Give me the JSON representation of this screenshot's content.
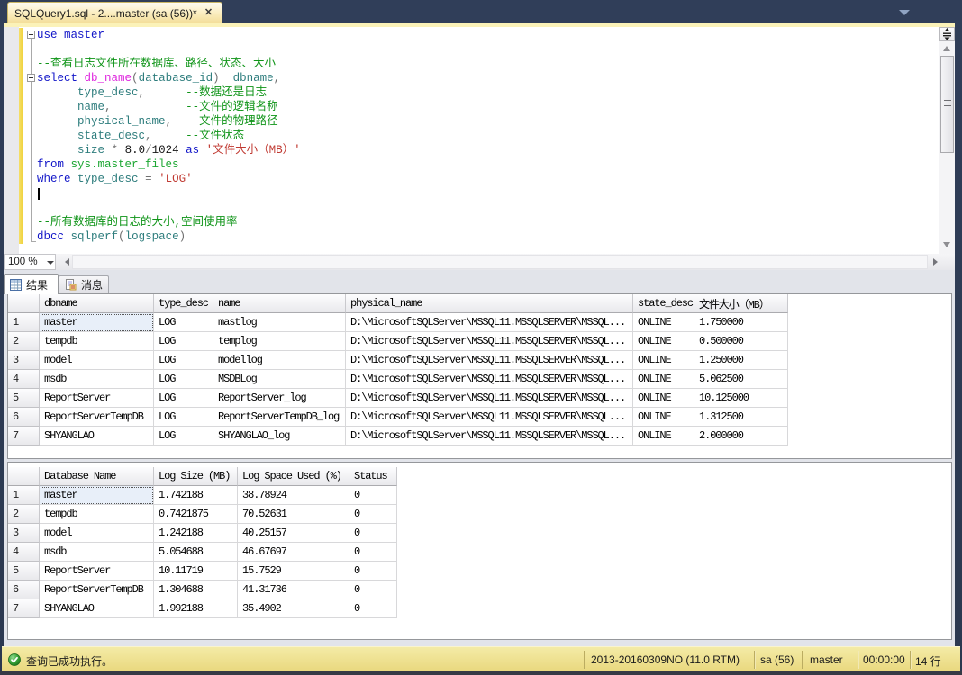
{
  "window": {
    "tab_title": "SQLQuery1.sql - 2....master (sa (56))*",
    "close_glyph": "✕"
  },
  "editor": {
    "zoom_value": "100 %",
    "lines": [
      [
        [
          "kw",
          "use"
        ],
        [
          "pl",
          " "
        ],
        [
          "kw",
          "master"
        ]
      ],
      [],
      [
        [
          "cm",
          "--查看日志文件所在数据库、路径、状态、大小"
        ]
      ],
      [
        [
          "kw",
          "select"
        ],
        [
          "pl",
          " "
        ],
        [
          "fn",
          "db_name"
        ],
        [
          "op",
          "("
        ],
        [
          "id",
          "database_id"
        ],
        [
          "op",
          ")"
        ],
        [
          "pl",
          "  "
        ],
        [
          "id",
          "dbname"
        ],
        [
          "op",
          ","
        ]
      ],
      [
        [
          "pl",
          "      "
        ],
        [
          "id",
          "type_desc"
        ],
        [
          "op",
          ","
        ],
        [
          "pl",
          "      "
        ],
        [
          "cm",
          "--数据还是日志"
        ]
      ],
      [
        [
          "pl",
          "      "
        ],
        [
          "id",
          "name"
        ],
        [
          "op",
          ","
        ],
        [
          "pl",
          "           "
        ],
        [
          "cm",
          "--文件的逻辑名称"
        ]
      ],
      [
        [
          "pl",
          "      "
        ],
        [
          "id",
          "physical_name"
        ],
        [
          "op",
          ","
        ],
        [
          "pl",
          "  "
        ],
        [
          "cm",
          "--文件的物理路径"
        ]
      ],
      [
        [
          "pl",
          "      "
        ],
        [
          "id",
          "state_desc"
        ],
        [
          "op",
          ","
        ],
        [
          "pl",
          "     "
        ],
        [
          "cm",
          "--文件状态"
        ]
      ],
      [
        [
          "pl",
          "      "
        ],
        [
          "id",
          "size"
        ],
        [
          "pl",
          " "
        ],
        [
          "op",
          "*"
        ],
        [
          "pl",
          " "
        ],
        [
          "num",
          "8.0"
        ],
        [
          "op",
          "/"
        ],
        [
          "num",
          "1024"
        ],
        [
          "pl",
          " "
        ],
        [
          "kw",
          "as"
        ],
        [
          "pl",
          " "
        ],
        [
          "str",
          "'文件大小（MB）'"
        ]
      ],
      [
        [
          "kw",
          "from"
        ],
        [
          "pl",
          " "
        ],
        [
          "st",
          "sys.master_files"
        ]
      ],
      [
        [
          "kw",
          "where"
        ],
        [
          "pl",
          " "
        ],
        [
          "id",
          "type_desc"
        ],
        [
          "pl",
          " "
        ],
        [
          "op",
          "="
        ],
        [
          "pl",
          " "
        ],
        [
          "str",
          "'LOG'"
        ]
      ],
      [],
      [],
      [
        [
          "cm",
          "--所有数据库的日志的大小,空间使用率"
        ]
      ],
      [
        [
          "kw",
          "dbcc"
        ],
        [
          "pl",
          " "
        ],
        [
          "id",
          "sqlperf"
        ],
        [
          "op",
          "("
        ],
        [
          "id",
          "logspace"
        ],
        [
          "op",
          ")"
        ]
      ]
    ]
  },
  "results": {
    "tabs": [
      {
        "label": "结果",
        "icon": "results-grid-icon"
      },
      {
        "label": "消息",
        "icon": "messages-icon"
      }
    ],
    "grid1": {
      "columns": [
        "dbname",
        "type_desc",
        "name",
        "physical_name",
        "state_desc",
        "文件大小（MB）"
      ],
      "rows": [
        {
          "n": "1",
          "cells": [
            "master",
            "LOG",
            "mastlog",
            "D:\\MicrosoftSQLServer\\MSSQL11.MSSQLSERVER\\MSSQL...",
            "ONLINE",
            "1.750000"
          ]
        },
        {
          "n": "2",
          "cells": [
            "tempdb",
            "LOG",
            "templog",
            "D:\\MicrosoftSQLServer\\MSSQL11.MSSQLSERVER\\MSSQL...",
            "ONLINE",
            "0.500000"
          ]
        },
        {
          "n": "3",
          "cells": [
            "model",
            "LOG",
            "modellog",
            "D:\\MicrosoftSQLServer\\MSSQL11.MSSQLSERVER\\MSSQL...",
            "ONLINE",
            "1.250000"
          ]
        },
        {
          "n": "4",
          "cells": [
            "msdb",
            "LOG",
            "MSDBLog",
            "D:\\MicrosoftSQLServer\\MSSQL11.MSSQLSERVER\\MSSQL...",
            "ONLINE",
            "5.062500"
          ]
        },
        {
          "n": "5",
          "cells": [
            "ReportServer",
            "LOG",
            "ReportServer_log",
            "D:\\MicrosoftSQLServer\\MSSQL11.MSSQLSERVER\\MSSQL...",
            "ONLINE",
            "10.125000"
          ]
        },
        {
          "n": "6",
          "cells": [
            "ReportServerTempDB",
            "LOG",
            "ReportServerTempDB_log",
            "D:\\MicrosoftSQLServer\\MSSQL11.MSSQLSERVER\\MSSQL...",
            "ONLINE",
            "1.312500"
          ]
        },
        {
          "n": "7",
          "cells": [
            "SHYANGLAO",
            "LOG",
            "SHYANGLAO_log",
            "D:\\MicrosoftSQLServer\\MSSQL11.MSSQLSERVER\\MSSQL...",
            "ONLINE",
            "2.000000"
          ]
        }
      ],
      "selected_cell": {
        "row": 0,
        "col": 0
      }
    },
    "grid2": {
      "columns": [
        "Database Name",
        "Log Size (MB)",
        "Log Space Used (%)",
        "Status"
      ],
      "rows": [
        {
          "n": "1",
          "cells": [
            "master",
            "1.742188",
            "38.78924",
            "0"
          ]
        },
        {
          "n": "2",
          "cells": [
            "tempdb",
            "0.7421875",
            "70.52631",
            "0"
          ]
        },
        {
          "n": "3",
          "cells": [
            "model",
            "1.242188",
            "40.25157",
            "0"
          ]
        },
        {
          "n": "4",
          "cells": [
            "msdb",
            "5.054688",
            "46.67697",
            "0"
          ]
        },
        {
          "n": "5",
          "cells": [
            "ReportServer",
            "10.11719",
            "15.7529",
            "0"
          ]
        },
        {
          "n": "6",
          "cells": [
            "ReportServerTempDB",
            "1.304688",
            "41.31736",
            "0"
          ]
        },
        {
          "n": "7",
          "cells": [
            "SHYANGLAO",
            "1.992188",
            "35.4902",
            "0"
          ]
        }
      ],
      "selected_cell": {
        "row": 0,
        "col": 0
      }
    }
  },
  "statusbar": {
    "message": "查询已成功执行。",
    "server": "2013-20160309NO (11.0 RTM)",
    "user": "sa (56)",
    "database": "master",
    "time": "00:00:00",
    "row_count": "14 行"
  },
  "colors": {
    "accent_tab_yellow": "#F3DD97",
    "chrome_dark_blue": "#2E3C55",
    "status_yellow": "#EDDD8B",
    "success_green": "#3DA73D"
  }
}
